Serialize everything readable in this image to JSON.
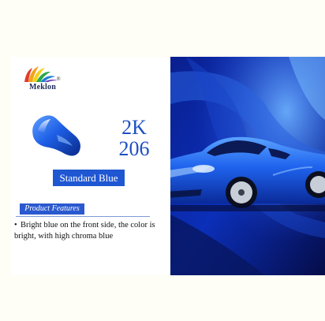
{
  "brand": {
    "name": "Meklon",
    "reg": "®"
  },
  "product": {
    "line1": "2K",
    "line2": "206"
  },
  "color_name": "Standard Blue",
  "features": {
    "title": "Product Features",
    "items": [
      "Bright blue on the front side, the color is bright, with high chroma blue"
    ]
  },
  "colors": {
    "accent": "#1f57d3",
    "code_text": "#1e4fc4",
    "car": "#1a5ae8",
    "panel_dark": "#0a1660"
  }
}
